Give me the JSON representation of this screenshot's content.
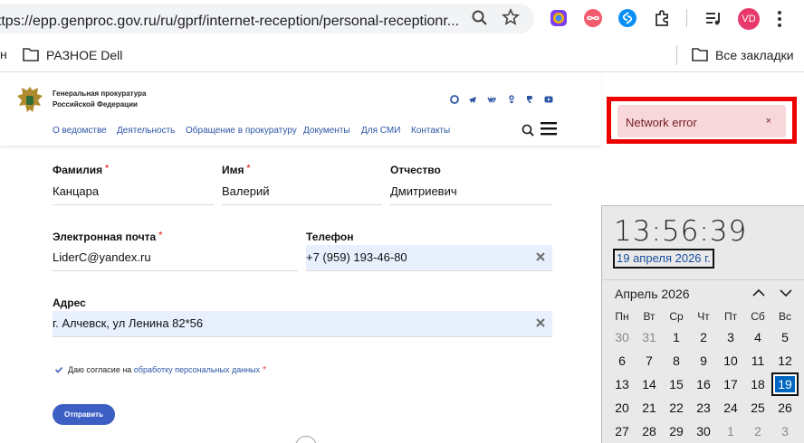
{
  "browser": {
    "url": "https://epp.genproc.gov.ru/ru/gprf/internet-reception/personal-receptionr...",
    "bookmarks_cut": "н",
    "bookmarks": [
      {
        "label": "РАЗНОЕ Dell"
      },
      {
        "label": "Все закладки"
      }
    ],
    "profile_initials": "VD"
  },
  "site": {
    "org_name_line1": "Генеральная прокуратура",
    "org_name_line2": "Российской Федерации",
    "nav": [
      "О ведомстве",
      "Деятельность",
      "Обращение в прокуратуру",
      "Документы",
      "Для СМИ",
      "Контакты"
    ]
  },
  "form": {
    "surname": {
      "label": "Фамилия",
      "value": "Канцара",
      "required": "*"
    },
    "name": {
      "label": "Имя",
      "value": "Валерий",
      "required": "*"
    },
    "patronymic": {
      "label": "Отчество",
      "value": "Дмитриевич"
    },
    "email": {
      "label": "Электронная почта",
      "value": "LiderC@yandex.ru",
      "required": "*"
    },
    "phone": {
      "label": "Телефон",
      "value": "+7 (959) 193-46-80"
    },
    "address": {
      "label": "Адрес",
      "value": "г. Алчевск, ул Ленина 82*56"
    },
    "consent_prefix": "Даю согласие на",
    "consent_link": "обработку персональных данных",
    "consent_req": "*",
    "submit_label": "Отправить"
  },
  "toast": {
    "message": "Network error",
    "close": "×"
  },
  "calendar": {
    "time": "13:56:39",
    "date": "19 апреля 2026 г.",
    "month": "Апрель 2026",
    "weekdays": [
      "Пн",
      "Вт",
      "Ср",
      "Чт",
      "Пт",
      "Сб",
      "Вс"
    ],
    "weeks": [
      [
        "30",
        "31",
        "1",
        "2",
        "3",
        "4",
        "5"
      ],
      [
        "6",
        "7",
        "8",
        "9",
        "10",
        "11",
        "12"
      ],
      [
        "13",
        "14",
        "15",
        "16",
        "17",
        "18",
        "19"
      ],
      [
        "20",
        "21",
        "22",
        "23",
        "24",
        "25",
        "26"
      ],
      [
        "27",
        "28",
        "29",
        "30",
        "1",
        "2",
        "3"
      ]
    ],
    "today": "19"
  },
  "colors": {
    "accent": "#3d5fc4",
    "link": "#2c55a5",
    "toast_bg": "#f8d7da",
    "highlight_frame": "#ee0000",
    "today_bg": "#0067c0"
  }
}
